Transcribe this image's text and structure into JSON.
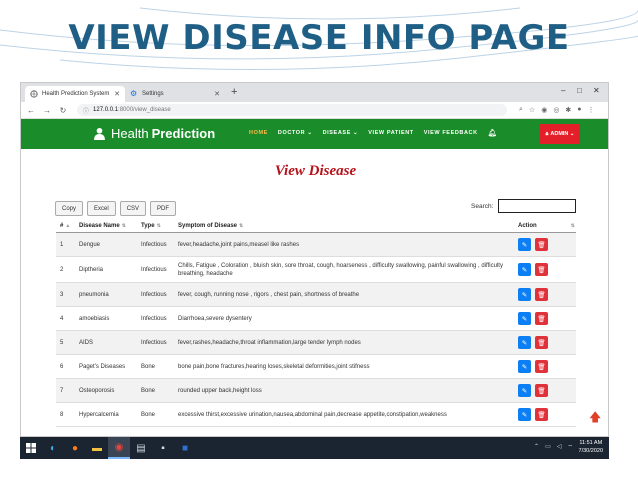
{
  "slide": {
    "title": "VIEW DISEASE INFO PAGE"
  },
  "browser": {
    "tabs": [
      {
        "label": "Health Prediction System",
        "active": true
      },
      {
        "label": "Settings",
        "active": false
      }
    ],
    "url_host": "127.0.0.1",
    "url_path": ":8000/view_disease"
  },
  "app": {
    "brand_light": "Health",
    "brand_bold": "Prediction",
    "nav": [
      "HOME",
      "DOCTOR ⌄",
      "DISEASE ⌄",
      "VIEW PATIENT",
      "VIEW FEEDBACK"
    ],
    "admin_label": "ADMIN ⌄",
    "page_heading": "View Disease"
  },
  "toolbar": {
    "buttons": [
      "Copy",
      "Excel",
      "CSV",
      "PDF"
    ],
    "search_label": "Search:"
  },
  "table": {
    "headers": [
      "#",
      "Disease Name",
      "Type",
      "Symptom of Disease",
      "Action"
    ],
    "rows": [
      {
        "num": "1",
        "name": "Dengue",
        "type": "Infectious",
        "symptoms": "fever,headache,joint pains,measel like rashes"
      },
      {
        "num": "2",
        "name": "Diptheria",
        "type": "Infectious",
        "symptoms": "Chills, Fatigue , Coloration , bluish skin, sore throat, cough, hoarseness , difficulty swallowing, painful swallowing , difficulty breathing, headache"
      },
      {
        "num": "3",
        "name": "pneumonia",
        "type": "Infectious",
        "symptoms": "fever, cough, running nose , rigors , chest pain, shortness of breathe"
      },
      {
        "num": "4",
        "name": "amoebiasis",
        "type": "Infectious",
        "symptoms": "Diarrhoea,severe dysentery"
      },
      {
        "num": "5",
        "name": "AIDS",
        "type": "Infectious",
        "symptoms": "fever,rashes,headache,throat inflammation,large tender lymph nodes"
      },
      {
        "num": "6",
        "name": "Paget's Diseases",
        "type": "Bone",
        "symptoms": "bone pain,bone fractures,hearing loses,skeletal deformities,joint stifness"
      },
      {
        "num": "7",
        "name": "Osteoporosis",
        "type": "Bone",
        "symptoms": "rounded upper back,height loss"
      },
      {
        "num": "8",
        "name": "Hypercalcemia",
        "type": "Bone",
        "symptoms": "excessive thirst,excessive urination,nausea,abdominal pain,decrease appetite,constipation,weakness"
      }
    ]
  },
  "taskbar": {
    "time": "11:51 AM",
    "date": "7/30/2020"
  },
  "colors": {
    "navbar": "#1a8d2a",
    "admin": "#e3202a",
    "heading": "#b5121b",
    "edit": "#0d7ff4",
    "delete": "#e0323a",
    "slide_title": "#1f5f86"
  }
}
